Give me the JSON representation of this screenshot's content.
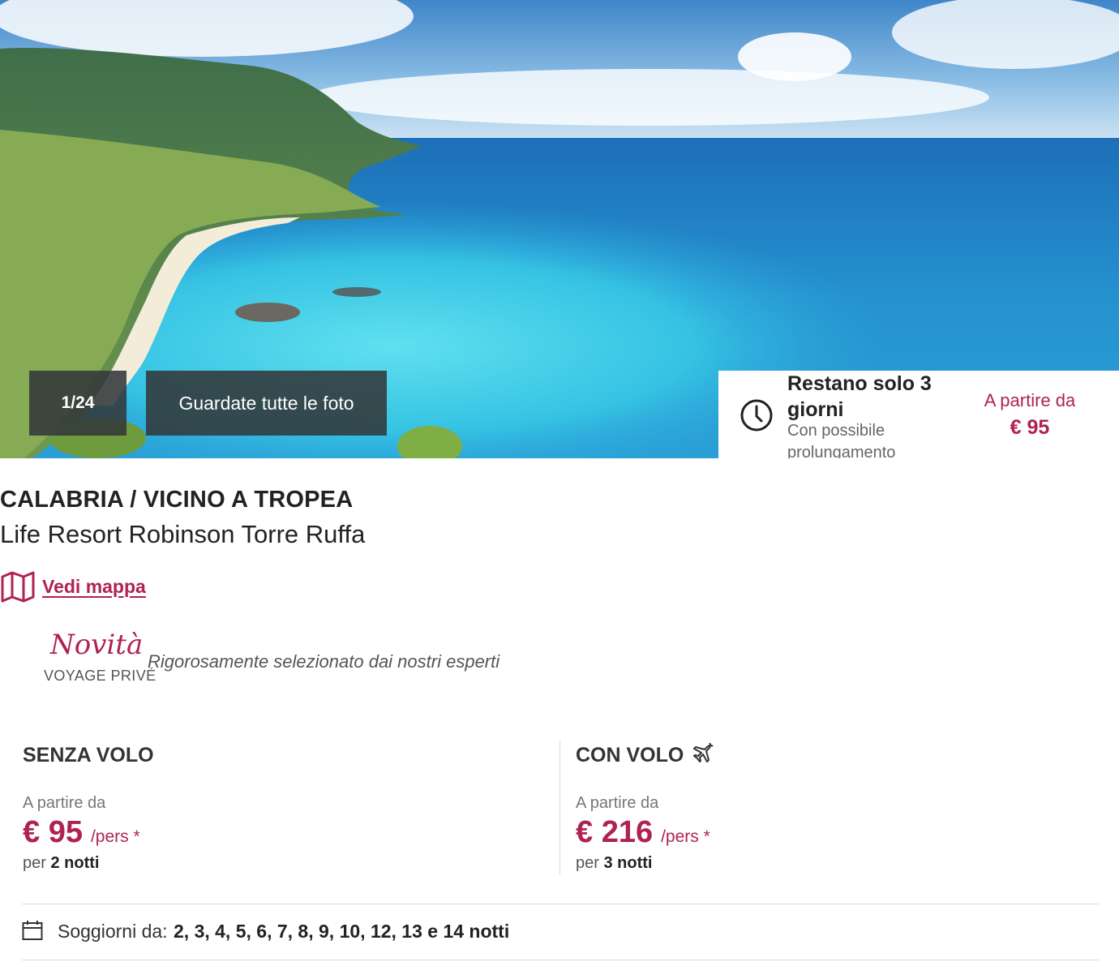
{
  "hero": {
    "photo_counter": "1/24",
    "all_photos_label": "Guardate tutte le foto",
    "remaining_title": "Restano solo 3 giorni",
    "remaining_subtitle": "Con possibile prolungamento",
    "price_label": "A partire da",
    "price": "€ 95"
  },
  "title": {
    "region": "CALABRIA / VICINO A TROPEA",
    "hotel_name": "Life Resort Robinson Torre Ruffa"
  },
  "map_link": {
    "label": "Vedi mappa"
  },
  "badge": {
    "novita": "Novità",
    "brand": "VOYAGE PRIVÉ",
    "description": "Rigorosamente selezionato dai nostri esperti"
  },
  "options": [
    {
      "title": "SENZA VOLO",
      "from_label": "A partire da",
      "price": "€ 95",
      "unit": "/pers *",
      "per_label": "per",
      "nights": "2 notti"
    },
    {
      "title": "CON VOLO",
      "icon": "plane-icon",
      "from_label": "A partire da",
      "price": "€ 216",
      "unit": "/pers *",
      "per_label": "per",
      "nights": "3 notti"
    }
  ],
  "stays": {
    "label": "Soggiorni da:",
    "values": "2, 3, 4, 5, 6, 7, 8, 9, 10, 12, 13 e 14 notti"
  },
  "colors": {
    "accent": "#b0234f",
    "text": "#222222",
    "muted": "#777777",
    "overlay": "#32383a"
  }
}
